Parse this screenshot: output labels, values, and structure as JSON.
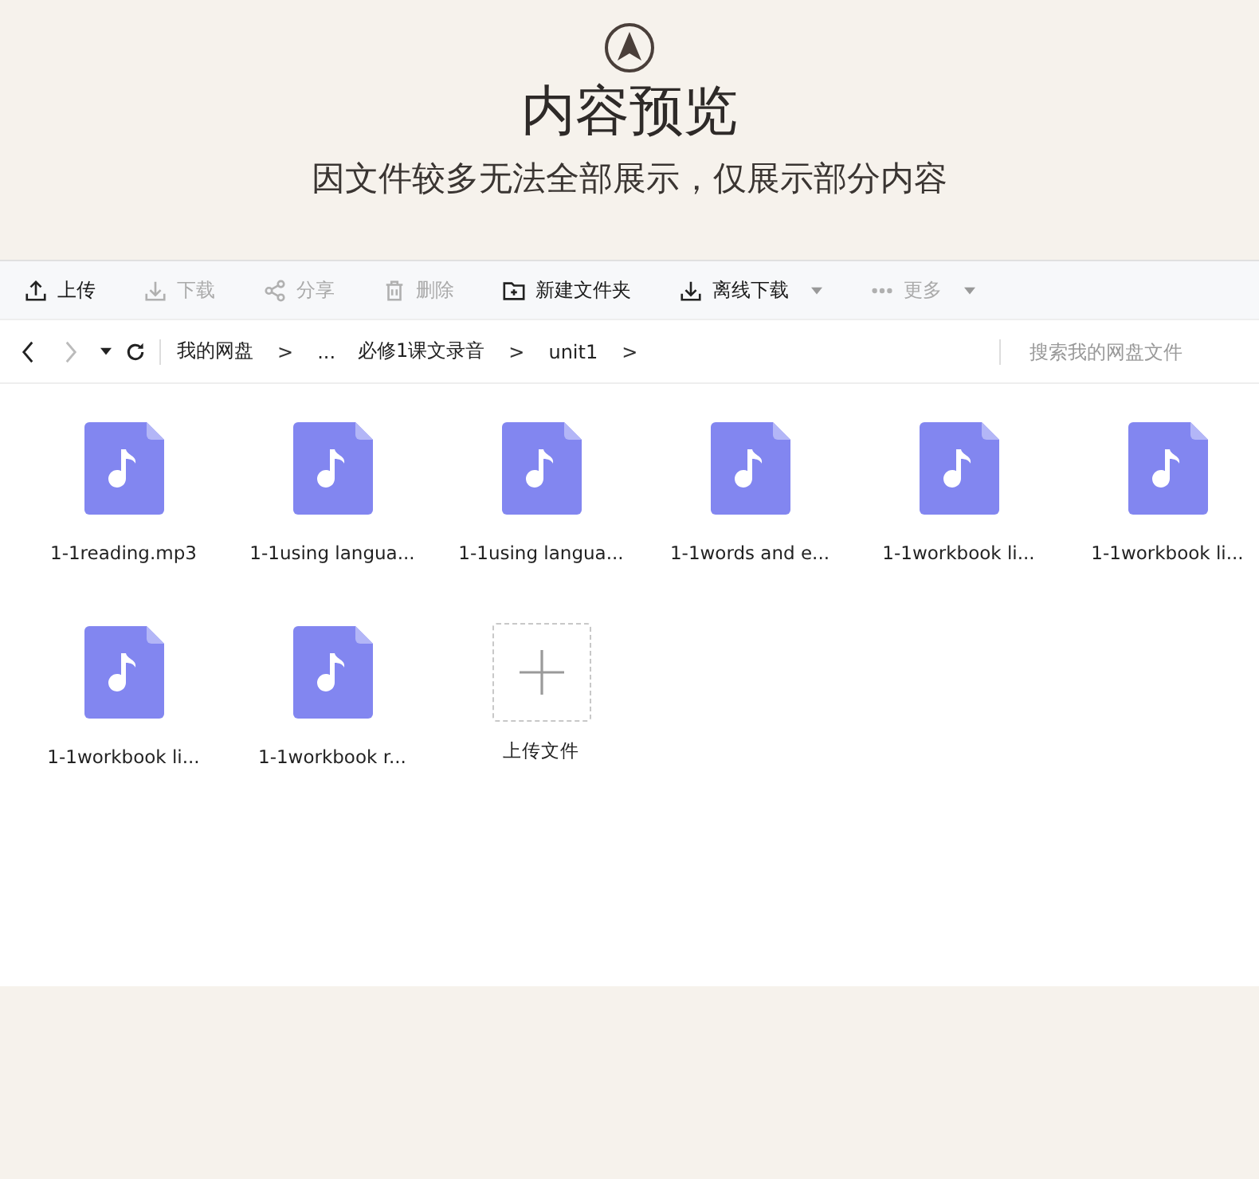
{
  "header": {
    "title": "内容预览",
    "subtitle": "因文件较多无法全部展示，仅展示部分内容"
  },
  "toolbar": [
    {
      "kind": "upload",
      "label": "上传",
      "disabled": false,
      "dropdown": false
    },
    {
      "kind": "download",
      "label": "下载",
      "disabled": true,
      "dropdown": false
    },
    {
      "kind": "share",
      "label": "分享",
      "disabled": true,
      "dropdown": false
    },
    {
      "kind": "delete",
      "label": "删除",
      "disabled": true,
      "dropdown": false
    },
    {
      "kind": "new-folder",
      "label": "新建文件夹",
      "disabled": false,
      "dropdown": false
    },
    {
      "kind": "offline-download",
      "label": "离线下载",
      "disabled": false,
      "dropdown": true
    },
    {
      "kind": "more",
      "label": "更多",
      "disabled": true,
      "dropdown": true
    }
  ],
  "nav": {
    "back_disabled": false,
    "forward_disabled": true,
    "breadcrumb": [
      {
        "kind": "crumb",
        "text": "我的网盘"
      },
      {
        "kind": "sep",
        "text": ">"
      },
      {
        "kind": "crumb",
        "text": "..."
      },
      {
        "kind": "crumb",
        "text": "必修1课文录音"
      },
      {
        "kind": "sep",
        "text": ">"
      },
      {
        "kind": "crumb",
        "text": "unit1"
      },
      {
        "kind": "sep",
        "text": ">"
      }
    ],
    "search": {
      "placeholder": "搜索我的网盘文件"
    }
  },
  "files": [
    {
      "kind": "audio",
      "name": "1-1reading.mp3"
    },
    {
      "kind": "audio",
      "name": "1-1using langua..."
    },
    {
      "kind": "audio",
      "name": "1-1using langua..."
    },
    {
      "kind": "audio",
      "name": "1-1words and e..."
    },
    {
      "kind": "audio",
      "name": "1-1workbook li..."
    },
    {
      "kind": "audio",
      "name": "1-1workbook li..."
    },
    {
      "kind": "audio",
      "name": "1-1workbook li..."
    },
    {
      "kind": "audio",
      "name": "1-1workbook r..."
    },
    {
      "kind": "upload",
      "name": "上传文件"
    }
  ]
}
